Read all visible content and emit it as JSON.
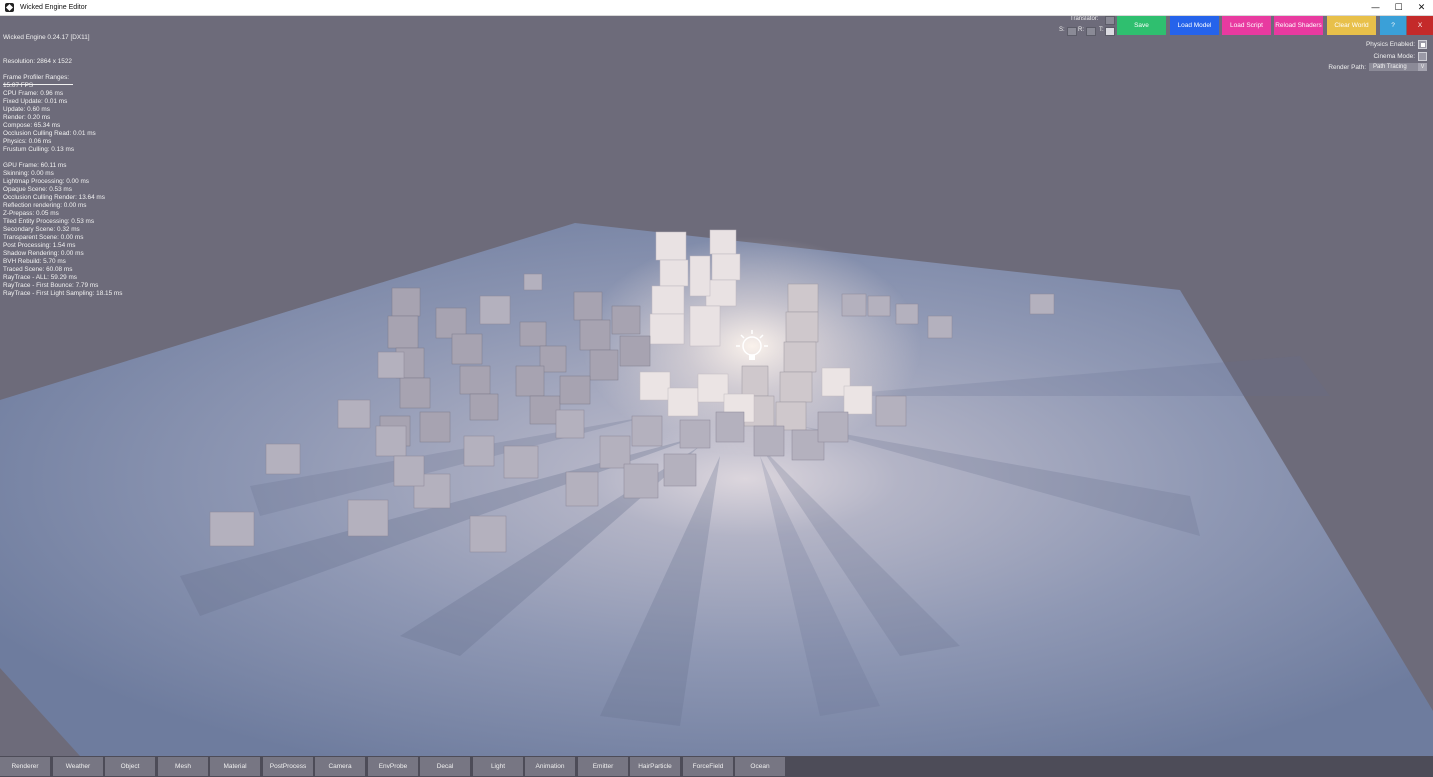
{
  "window": {
    "title": "Wicked Engine Editor",
    "minimize": "—",
    "maximize": "☐",
    "close": "✕"
  },
  "info": {
    "engine": "Wicked Engine 0.24.17 [DX11]",
    "resolution": "Resolution: 2864 x 1522",
    "fps": "15.07 FPS"
  },
  "profiler": {
    "title": "Frame Profiler Ranges:",
    "cpu_group": [
      "CPU Frame: 0.96 ms",
      "Fixed Update: 0.01 ms",
      "Update: 0.60 ms",
      "Render: 0.20 ms",
      "Compose: 65.34 ms",
      "Occlusion Culling Read: 0.01 ms",
      "Physics: 0.06 ms",
      "Frustum Culling: 0.13 ms"
    ],
    "gpu_group": [
      "GPU Frame: 60.11 ms",
      "Skinning: 0.00 ms",
      "Lightmap Processing: 0.00 ms",
      "Opaque Scene: 0.53 ms",
      "Occlusion Culling Render: 13.64 ms",
      "Reflection rendering: 0.00 ms",
      "Z-Prepass: 0.05 ms",
      "Tiled Entity Processing: 0.53 ms",
      "Secondary Scene: 0.32 ms",
      "Transparent Scene: 0.00 ms",
      "Post Processing: 1.54 ms",
      "Shadow Rendering: 0.00 ms",
      "BVH Rebuild: 5.70 ms",
      "Traced Scene: 60.08 ms",
      "RayTrace - ALL: 59.29 ms",
      "RayTrace - First Bounce: 7.79 ms",
      "RayTrace - First Light Sampling: 18.15 ms"
    ]
  },
  "translator": {
    "title": "Translator:",
    "s": "S:",
    "r": "R:",
    "t": "T:"
  },
  "toolbar": {
    "save": "Save",
    "load_model": "Load Model",
    "load_script": "Load Script",
    "reload_shaders": "Reload Shaders",
    "clear_world": "Clear World",
    "help": "?",
    "exit": "X"
  },
  "colors": {
    "save": "#2fbf6f",
    "load_model": "#2563eb",
    "load_script": "#e83aa0",
    "reload_shaders": "#e83aa0",
    "clear_world": "#e8c04a",
    "help": "#3aa0d8",
    "exit": "#c42a2a"
  },
  "options": {
    "physics_label": "Physics Enabled:",
    "cinema_label": "Cinema Mode:",
    "render_path_label": "Render Path:",
    "render_path_value": "Path Tracing",
    "render_path_arrow": "V"
  },
  "tabs": [
    "Renderer",
    "Weather",
    "Object",
    "Mesh",
    "Material",
    "PostProcess",
    "Camera",
    "EnvProbe",
    "Decal",
    "Light",
    "Animation",
    "Emitter",
    "HairParticle",
    "ForceField",
    "Ocean"
  ]
}
